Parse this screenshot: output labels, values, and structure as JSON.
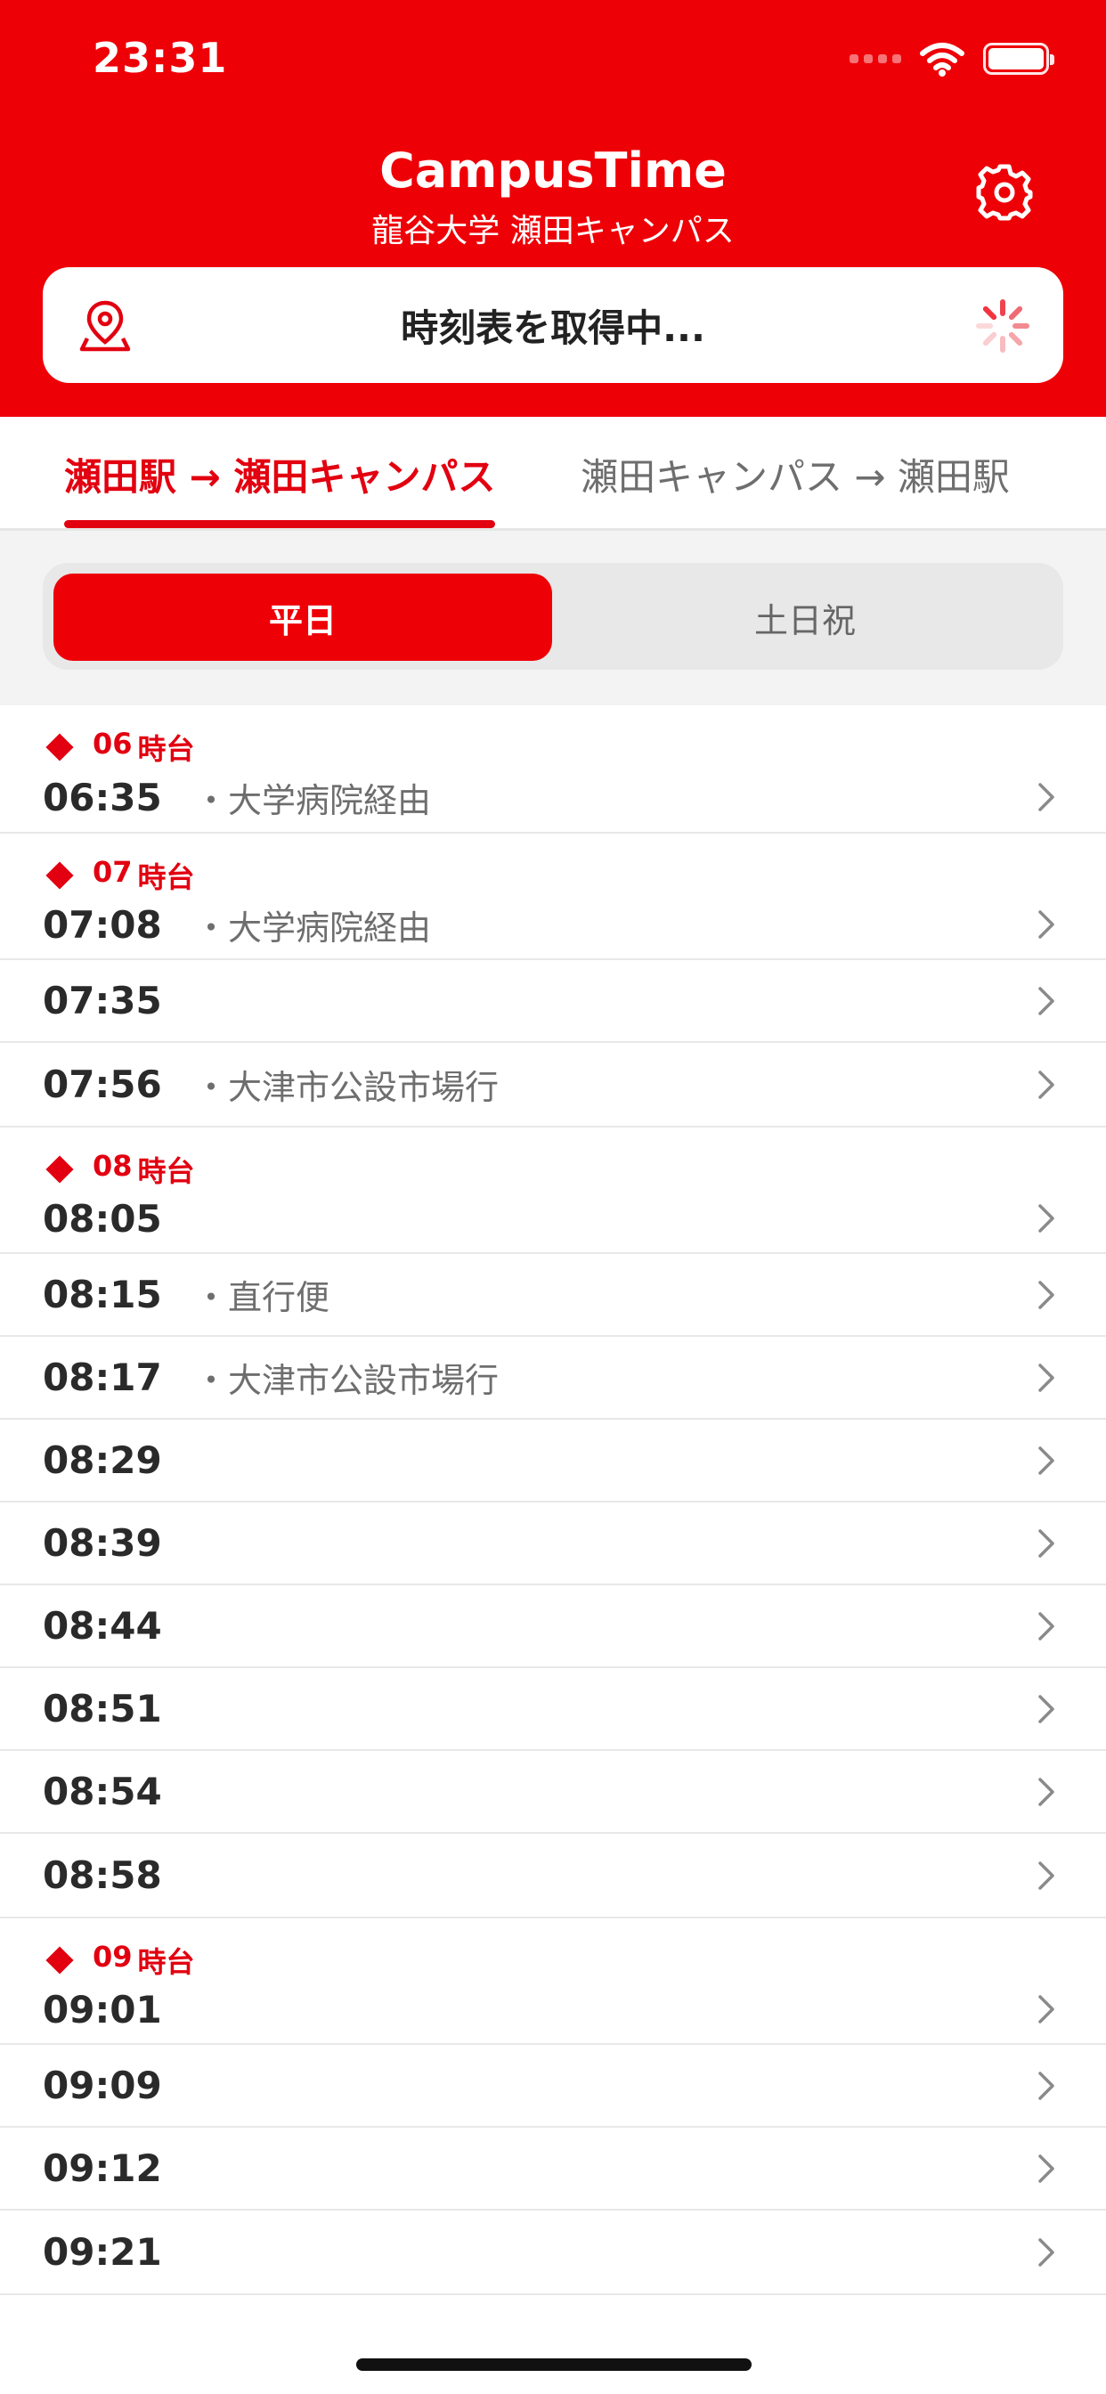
{
  "status_bar": {
    "time": "23:31"
  },
  "header": {
    "title": "CampusTime",
    "subtitle": "龍谷大学 瀬田キャンパス",
    "status_message": "時刻表を取得中...",
    "accent_color": "#ee0007"
  },
  "direction_tabs": {
    "active": "瀬田駅 → 瀬田キャンパス",
    "inactive": "瀬田キャンパス → 瀬田駅"
  },
  "day_selector": {
    "active": "平日",
    "inactive": "土日祝"
  },
  "timetable": [
    {
      "hour": "06",
      "suffix": "時台",
      "departures": [
        {
          "time": "06:35",
          "note": "大学病院経由"
        }
      ]
    },
    {
      "hour": "07",
      "suffix": "時台",
      "departures": [
        {
          "time": "07:08",
          "note": "大学病院経由"
        },
        {
          "time": "07:35",
          "note": ""
        },
        {
          "time": "07:56",
          "note": "大津市公設市場行"
        }
      ]
    },
    {
      "hour": "08",
      "suffix": "時台",
      "departures": [
        {
          "time": "08:05",
          "note": ""
        },
        {
          "time": "08:15",
          "note": "直行便"
        },
        {
          "time": "08:17",
          "note": "大津市公設市場行"
        },
        {
          "time": "08:29",
          "note": ""
        },
        {
          "time": "08:39",
          "note": ""
        },
        {
          "time": "08:44",
          "note": ""
        },
        {
          "time": "08:51",
          "note": ""
        },
        {
          "time": "08:54",
          "note": ""
        },
        {
          "time": "08:58",
          "note": ""
        }
      ]
    },
    {
      "hour": "09",
      "suffix": "時台",
      "departures": [
        {
          "time": "09:01",
          "note": ""
        },
        {
          "time": "09:09",
          "note": ""
        },
        {
          "time": "09:12",
          "note": ""
        },
        {
          "time": "09:21",
          "note": ""
        }
      ]
    }
  ]
}
